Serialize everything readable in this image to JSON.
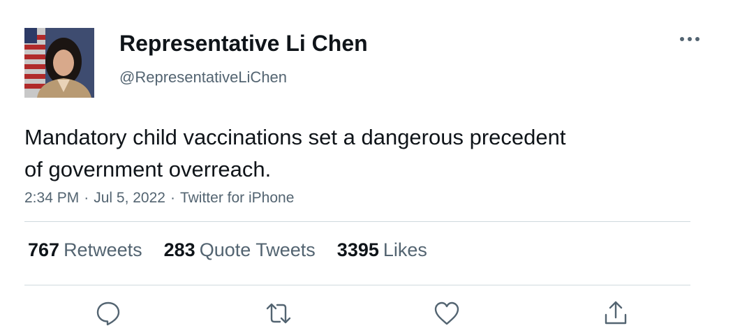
{
  "author": {
    "name": "Representative Li Chen",
    "handle": "@RepresentativeLiChen",
    "avatar_icon": "portrait-photo"
  },
  "tweet": {
    "text_line1": "Mandatory child vaccinations set a dangerous precedent",
    "text_line2": "of government overreach.",
    "time": "2:34 PM",
    "date": "Jul 5, 2022",
    "source": "Twitter for iPhone",
    "separator": "·"
  },
  "stats": {
    "retweets": {
      "count": "767",
      "label": "Retweets"
    },
    "quotes": {
      "count": "283",
      "label": "Quote Tweets"
    },
    "likes": {
      "count": "3395",
      "label": "Likes"
    }
  },
  "actions": [
    "reply-icon",
    "retweet-icon",
    "like-icon",
    "share-icon"
  ],
  "colors": {
    "text": "#0f1419",
    "secondary": "#536471",
    "divider": "#cfd9de",
    "icon": "#536471"
  }
}
